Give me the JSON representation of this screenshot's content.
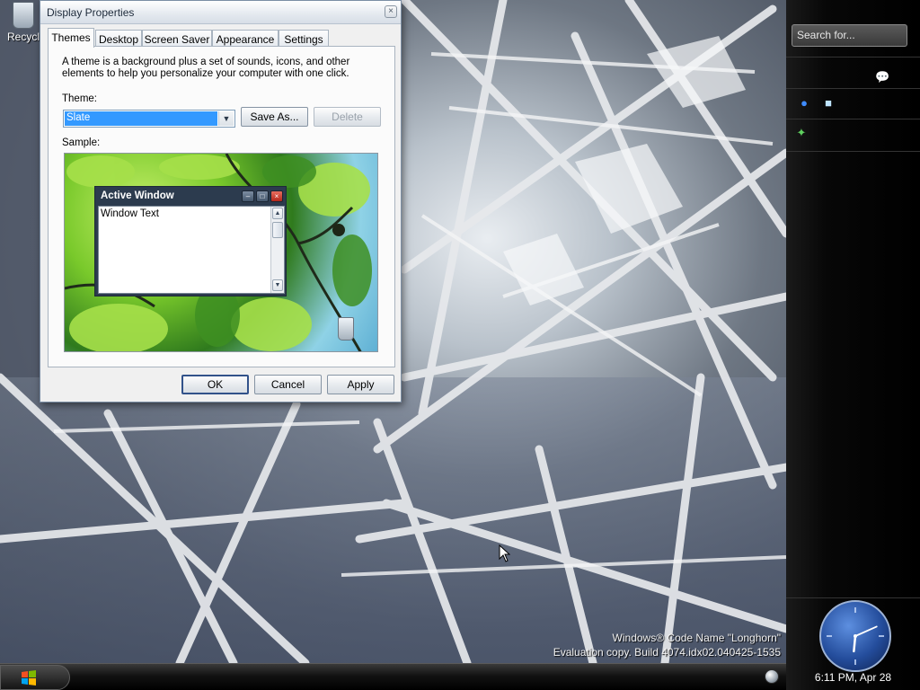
{
  "desktop": {
    "recycle_bin_label": "Recycl",
    "watermark_line1": "Windows® Code Name \"Longhorn\"",
    "watermark_line2": "Evaluation copy. Build 4074.idx02.040425-1535"
  },
  "dialog": {
    "title": "Display Properties",
    "close_glyph": "×",
    "tabs": [
      {
        "label": "Themes",
        "active": true
      },
      {
        "label": "Desktop",
        "active": false
      },
      {
        "label": "Screen Saver",
        "active": false
      },
      {
        "label": "Appearance",
        "active": false
      },
      {
        "label": "Settings",
        "active": false
      }
    ],
    "description": "A theme is a background plus a set of sounds, icons, and other elements to help you personalize your computer with one click.",
    "theme_label": "Theme:",
    "theme_value": "Slate",
    "save_as_label": "Save As...",
    "delete_label": "Delete",
    "sample_label": "Sample:",
    "sample_window": {
      "title": "Active Window",
      "text": "Window Text"
    },
    "ok_label": "OK",
    "cancel_label": "Cancel",
    "apply_label": "Apply"
  },
  "sidebar": {
    "search_placeholder": "Search for...",
    "clock_text": "6:11 PM, Apr 28",
    "clock_time": {
      "hour": 6,
      "minute": 11
    }
  },
  "colors": {
    "selection": "#3399ff",
    "active_title": "#2c3b4e",
    "sidebar_bg": "#000000"
  }
}
